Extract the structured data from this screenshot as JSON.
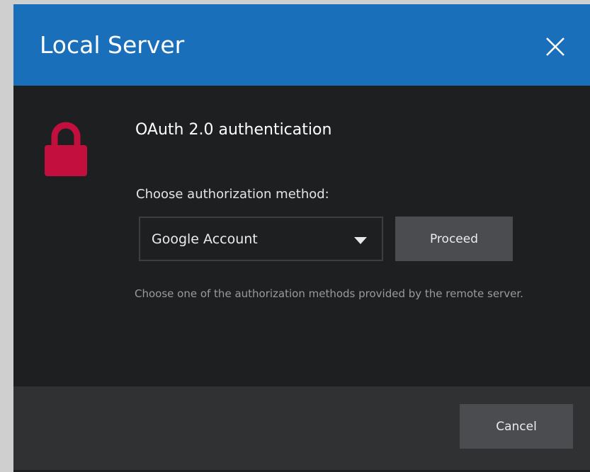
{
  "dialog": {
    "title": "Local Server",
    "accent_color": "#1a6fbb",
    "close_icon": "close-icon"
  },
  "content": {
    "lock_icon": "lock-icon",
    "lock_color": "#c20f3d",
    "heading": "OAuth 2.0 authentication",
    "method_label": "Choose authorization method:",
    "method_select": {
      "value": "Google Account",
      "arrow_icon": "caret-down-icon"
    },
    "proceed_label": "Proceed",
    "hint": "Choose one of the authorization methods provided by the remote server."
  },
  "footer": {
    "cancel_label": "Cancel"
  }
}
